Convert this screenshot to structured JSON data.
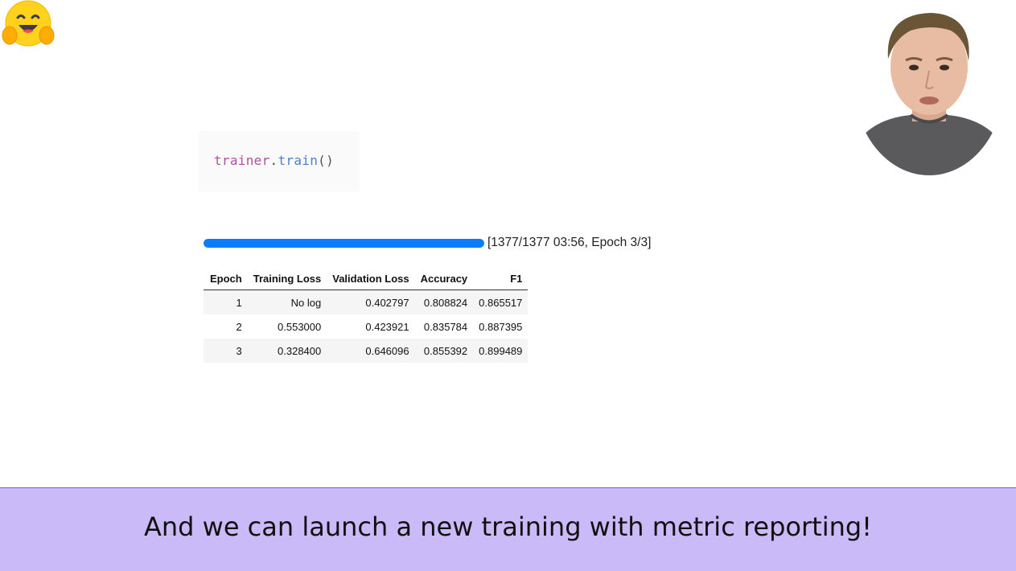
{
  "code": {
    "object": "trainer",
    "dot": ".",
    "method": "train",
    "parens": "()"
  },
  "progress": {
    "fraction": 1.0,
    "status_text": "[1377/1377 03:56, Epoch 3/3]"
  },
  "results_table": {
    "headers": [
      "Epoch",
      "Training Loss",
      "Validation Loss",
      "Accuracy",
      "F1"
    ],
    "rows": [
      [
        "1",
        "No log",
        "0.402797",
        "0.808824",
        "0.865517"
      ],
      [
        "2",
        "0.553000",
        "0.423921",
        "0.835784",
        "0.887395"
      ],
      [
        "3",
        "0.328400",
        "0.646096",
        "0.855392",
        "0.899489"
      ]
    ]
  },
  "subtitle": "And we can launch a new training with metric reporting!",
  "colors": {
    "progress_fill": "#0a7cff",
    "subtitle_bg": "#cbbaf8",
    "code_var": "#b24fa0",
    "code_fn": "#4a7fd0"
  },
  "icons": {
    "logo": "hugging-face-emoji-icon",
    "presenter": "presenter-video-avatar"
  }
}
